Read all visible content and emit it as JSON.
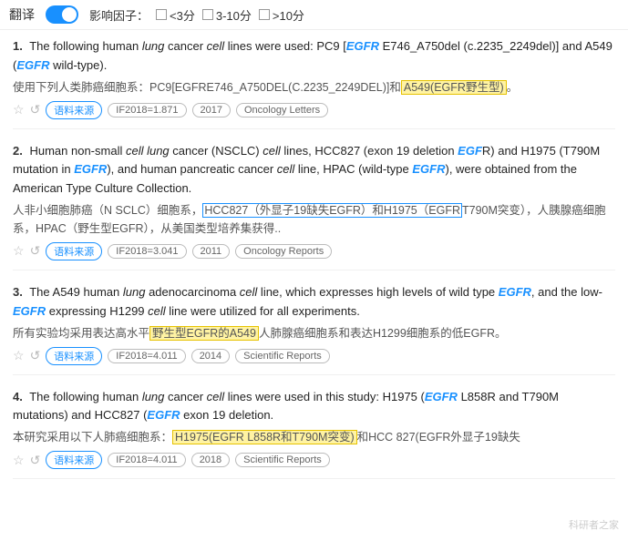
{
  "topbar": {
    "translate_label": "翻译",
    "impact_label": "影响因子：",
    "filter1_label": "<3分",
    "filter2_label": "3-10分",
    "filter3_label": ">10分"
  },
  "results": [
    {
      "num": "1.",
      "en_parts": [
        {
          "text": "The following human ",
          "style": "normal"
        },
        {
          "text": "lung",
          "style": "italic"
        },
        {
          "text": " cancer ",
          "style": "normal"
        },
        {
          "text": "cell",
          "style": "italic"
        },
        {
          "text": " lines were used: PC9 [",
          "style": "normal"
        },
        {
          "text": "EGFR",
          "style": "italic-bold"
        },
        {
          "text": " E746_A750del (c.2235_2249del)] and A549 (",
          "style": "normal"
        },
        {
          "text": "EGFR",
          "style": "italic-bold"
        },
        {
          "text": " wild-type).",
          "style": "normal"
        }
      ],
      "cn_before": "使用下列人类肺癌细胞系：PC9[EGFRE746_A750DEL(C.2235_2249DEL)]和",
      "cn_highlight": "A549(EGFR野生型)",
      "cn_after": "。",
      "meta_if": "IF2018=1.871",
      "meta_year": "2017",
      "meta_journal": "Oncology Letters"
    },
    {
      "num": "2.",
      "en_parts": [
        {
          "text": "Human non-small ",
          "style": "normal"
        },
        {
          "text": "cell lung",
          "style": "italic"
        },
        {
          "text": " cancer (NSCLC) ",
          "style": "normal"
        },
        {
          "text": "cell",
          "style": "italic"
        },
        {
          "text": " lines, HCC827 (exon 19 deletion ",
          "style": "normal"
        },
        {
          "text": "EGF",
          "style": "italic-bold"
        },
        {
          "text": "R) and H1975 (T790M mutation in ",
          "style": "normal"
        },
        {
          "text": "EGFR",
          "style": "italic-bold"
        },
        {
          "text": "), and human pancreatic cancer ",
          "style": "normal"
        },
        {
          "text": "cell",
          "style": "italic"
        },
        {
          "text": " line, HPAC (wild-type ",
          "style": "normal"
        },
        {
          "text": "EGFR",
          "style": "italic-bold"
        },
        {
          "text": "), were obtained from the American Type Culture Collection.",
          "style": "normal"
        }
      ],
      "cn_before": "人非小细胞肺癌（N SCLC）细胞系，",
      "cn_highlight1": "HCC827（外显子19缺失EGFR）和H1975（EGFR",
      "cn_highlight1_end": "T790M突变）",
      "cn_after": "，人胰腺癌细胞系，HPAC（野生型EGFR），从美国类型培养集获得..",
      "meta_if": "IF2018=3.041",
      "meta_year": "2011",
      "meta_journal": "Oncology Reports"
    },
    {
      "num": "3.",
      "en_parts": [
        {
          "text": "The A549 human ",
          "style": "normal"
        },
        {
          "text": "lung",
          "style": "italic"
        },
        {
          "text": " adenocarcinoma ",
          "style": "normal"
        },
        {
          "text": "cell",
          "style": "italic"
        },
        {
          "text": " line, which expresses high levels of wild type ",
          "style": "normal"
        },
        {
          "text": "EGFR",
          "style": "italic-bold"
        },
        {
          "text": ", and the low-",
          "style": "normal"
        },
        {
          "text": "EGFR",
          "style": "italic-bold"
        },
        {
          "text": " expressing H1299 ",
          "style": "normal"
        },
        {
          "text": "cell",
          "style": "italic"
        },
        {
          "text": " line were utilized for all experiments.",
          "style": "normal"
        }
      ],
      "cn_before": "所有实验均采用表达高水平",
      "cn_highlight": "野生型EGFR的A549",
      "cn_after": "人肺腺癌细胞系和表达H1299细胞系的低EGFR。",
      "meta_if": "IF2018=4.011",
      "meta_year": "2014",
      "meta_journal": "Scientific Reports"
    },
    {
      "num": "4.",
      "en_parts": [
        {
          "text": "The following human ",
          "style": "normal"
        },
        {
          "text": "lung",
          "style": "italic"
        },
        {
          "text": " cancer ",
          "style": "normal"
        },
        {
          "text": "cell",
          "style": "italic"
        },
        {
          "text": " lines were used in this study: H1975 (",
          "style": "normal"
        },
        {
          "text": "EGFR",
          "style": "italic-bold"
        },
        {
          "text": " L858R and T790M mutations) and HCC827 (",
          "style": "normal"
        },
        {
          "text": "EGFR",
          "style": "italic-bold"
        },
        {
          "text": " exon 19 deletion.",
          "style": "normal"
        }
      ],
      "cn_before": "本研究采用以下人肺癌细胞系：",
      "cn_highlight": "H1975(EGFR L858R和T790M突变)",
      "cn_after": "和HCC 827(EGFR外显子19缺失",
      "meta_if": "IF2018=4.011",
      "meta_year": "2018",
      "meta_journal": "Scientific Reports"
    }
  ],
  "watermark": "科研者之家"
}
